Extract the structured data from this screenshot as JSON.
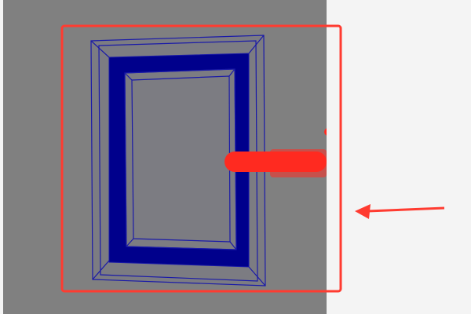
{
  "viewport": {
    "background": "#808080",
    "wire_color": "#1a1aa8",
    "fill_color": "#00008c",
    "panel_face": "#7c7c82",
    "manipulator_color": "#ff2a20"
  },
  "side_panel": {
    "background": "#f4f4f4"
  },
  "annotation": {
    "color": "#ff3b30",
    "shapes": [
      "highlight-rectangle",
      "pointer-arrow"
    ]
  }
}
